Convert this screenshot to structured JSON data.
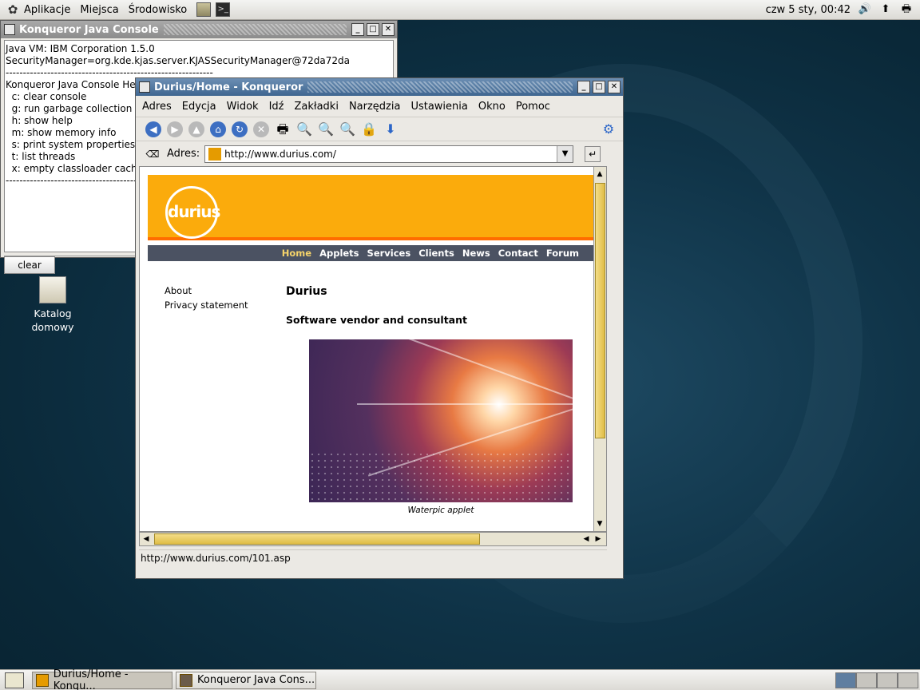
{
  "top_panel": {
    "menus": [
      "Aplikacje",
      "Miejsca",
      "Środowisko"
    ],
    "clock": "czw  5 sty, 00:42"
  },
  "console": {
    "title": "Konqueror Java Console",
    "lines": [
      "Java VM: IBM Corporation 1.5.0",
      "SecurityManager=org.kde.kjas.server.KJASSecurityManager@72da72da",
      "------------------------------------------------------------",
      "Konqueror Java Console Help",
      "  c: clear console",
      "  g: run garbage collection",
      "  h: show help",
      "  m: show memory info",
      "  s: print system properties",
      "  t: list threads",
      "  x: empty classloader cache",
      "------------------------------------------------------------"
    ],
    "clear_label": "clear"
  },
  "browser": {
    "title": "Durius/Home - Konqueror",
    "menus": [
      "Adres",
      "Edycja",
      "Widok",
      "Idź",
      "Zakładki",
      "Narzędzia",
      "Ustawienia",
      "Okno",
      "Pomoc"
    ],
    "location_label": "Adres:",
    "url": "http://www.durius.com/",
    "status": "http://www.durius.com/101.asp",
    "page": {
      "logo_text": "durius",
      "nav": [
        "Home",
        "Applets",
        "Services",
        "Clients",
        "News",
        "Contact",
        "Forum"
      ],
      "side_links": [
        "About",
        "Privacy statement"
      ],
      "heading": "Durius",
      "subheading": "Software vendor and consultant",
      "caption": "Waterpic applet"
    }
  },
  "desktop_icon": {
    "label_line1": "Katalog",
    "label_line2": "domowy"
  },
  "taskbar": {
    "tasks": [
      "Durius/Home - Konqu...",
      "Konqueror Java Cons..."
    ]
  },
  "colors": {
    "durius_orange": "#fbab0c",
    "nav_bg": "#4b5262",
    "title_active": "#3f6690"
  }
}
